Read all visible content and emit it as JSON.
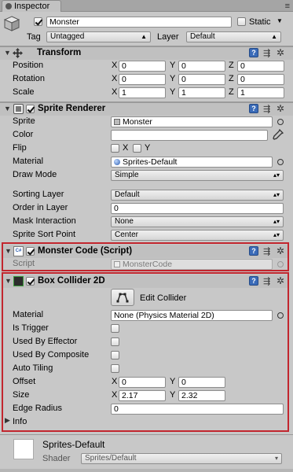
{
  "window": {
    "tab_label": "Inspector"
  },
  "header": {
    "object_name": "Monster",
    "static_label": "Static",
    "tag_label": "Tag",
    "tag_value": "Untagged",
    "layer_label": "Layer",
    "layer_value": "Default",
    "active": true,
    "is_static": false
  },
  "transform": {
    "title": "Transform",
    "position_label": "Position",
    "rotation_label": "Rotation",
    "scale_label": "Scale",
    "position": {
      "x": "0",
      "y": "0",
      "z": "0"
    },
    "rotation": {
      "x": "0",
      "y": "0",
      "z": "0"
    },
    "scale": {
      "x": "1",
      "y": "1",
      "z": "1"
    },
    "axis_x": "X",
    "axis_y": "Y",
    "axis_z": "Z"
  },
  "sprite_renderer": {
    "title": "Sprite Renderer",
    "enabled": true,
    "sprite_label": "Sprite",
    "sprite_value": "Monster",
    "color_label": "Color",
    "color_value": "#ffffff",
    "flip_label": "Flip",
    "flip_x": "X",
    "flip_y": "Y",
    "material_label": "Material",
    "material_value": "Sprites-Default",
    "draw_mode_label": "Draw Mode",
    "draw_mode_value": "Simple",
    "sorting_layer_label": "Sorting Layer",
    "sorting_layer_value": "Default",
    "order_in_layer_label": "Order in Layer",
    "order_in_layer_value": "0",
    "mask_interaction_label": "Mask Interaction",
    "mask_interaction_value": "None",
    "sprite_sort_point_label": "Sprite Sort Point",
    "sprite_sort_point_value": "Center"
  },
  "monster_code": {
    "title": "Monster Code (Script)",
    "enabled": true,
    "script_label": "Script",
    "script_value": "MonsterCode"
  },
  "box_collider": {
    "title": "Box Collider 2D",
    "enabled": true,
    "edit_collider_label": "Edit Collider",
    "material_label": "Material",
    "material_value": "None (Physics Material 2D)",
    "is_trigger_label": "Is Trigger",
    "used_by_effector_label": "Used By Effector",
    "used_by_composite_label": "Used By Composite",
    "auto_tiling_label": "Auto Tiling",
    "offset_label": "Offset",
    "offset": {
      "x": "0",
      "y": "0"
    },
    "size_label": "Size",
    "size": {
      "x": "2.17",
      "y": "2.32"
    },
    "edge_radius_label": "Edge Radius",
    "edge_radius_value": "0",
    "info_label": "Info"
  },
  "material_preview": {
    "name": "Sprites-Default",
    "shader_label": "Shader",
    "shader_value": "Sprites/Default"
  },
  "colors": {
    "panel_bg": "#c8c8c8",
    "highlight_border": "#c2262e",
    "help_icon": "#3a6bb8"
  }
}
